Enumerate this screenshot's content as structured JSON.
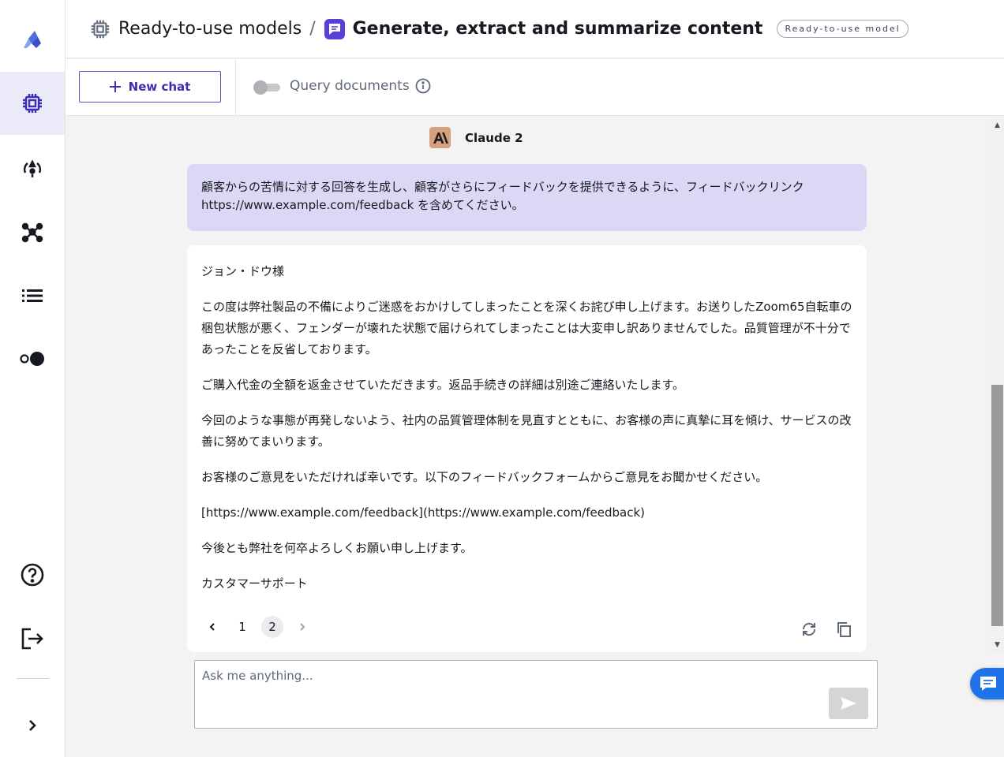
{
  "colors": {
    "accent": "#3b2fb1",
    "user_bubble": "#dbd8f5",
    "active_rail": "#ebeaf8",
    "anthropic": "#d4a27f",
    "float_button": "#1f73e8"
  },
  "rail": {
    "items": [
      {
        "icon": "app-logo-icon"
      },
      {
        "icon": "ready-to-use-models-icon",
        "active": true
      },
      {
        "icon": "my-models-icon"
      },
      {
        "icon": "datasets-icon"
      },
      {
        "icon": "list-icon"
      },
      {
        "icon": "toggle-view-icon"
      },
      {
        "icon": "help-icon"
      },
      {
        "icon": "logout-icon"
      },
      {
        "icon": "expand-icon"
      }
    ]
  },
  "header": {
    "breadcrumb_root": "Ready-to-use models",
    "separator": "/",
    "current": "Generate, extract and summarize content",
    "badge": "Ready-to-use model"
  },
  "toolbar": {
    "new_chat_label": "New chat",
    "query_documents_label": "Query documents",
    "query_documents_enabled": false
  },
  "chat": {
    "model_name": "Claude 2",
    "user_message": "顧客からの苦情に対する回答を生成し、顧客がさらにフィードバックを提供できるように、フィードバックリンク https://www.example.com/feedback を含めてください。",
    "assistant_paragraphs": [
      "ジョン・ドウ様",
      "この度は弊社製品の不備によりご迷惑をおかけしてしまったことを深くお詫び申し上げます。お送りしたZoom65自転車の梱包状態が悪く、フェンダーが壊れた状態で届けられてしまったことは大変申し訳ありませんでした。品質管理が不十分であったことを反省しております。",
      "ご購入代金の全額を返金させていただきます。返品手続きの詳細は別途ご連絡いたします。",
      "今回のような事態が再発しないよう、社内の品質管理体制を見直すとともに、お客様の声に真摯に耳を傾け、サービスの改善に努めてまいります。",
      "お客様のご意見をいただければ幸いです。以下のフィードバックフォームからご意見をお聞かせください。",
      "[https://www.example.com/feedback](https://www.example.com/feedback)",
      "今後とも弊社を何卒よろしくお願い申し上げます。",
      "カスタマーサポート"
    ],
    "pager": {
      "pages": [
        "1",
        "2"
      ],
      "current": "2"
    },
    "input_placeholder": "Ask me anything..."
  }
}
